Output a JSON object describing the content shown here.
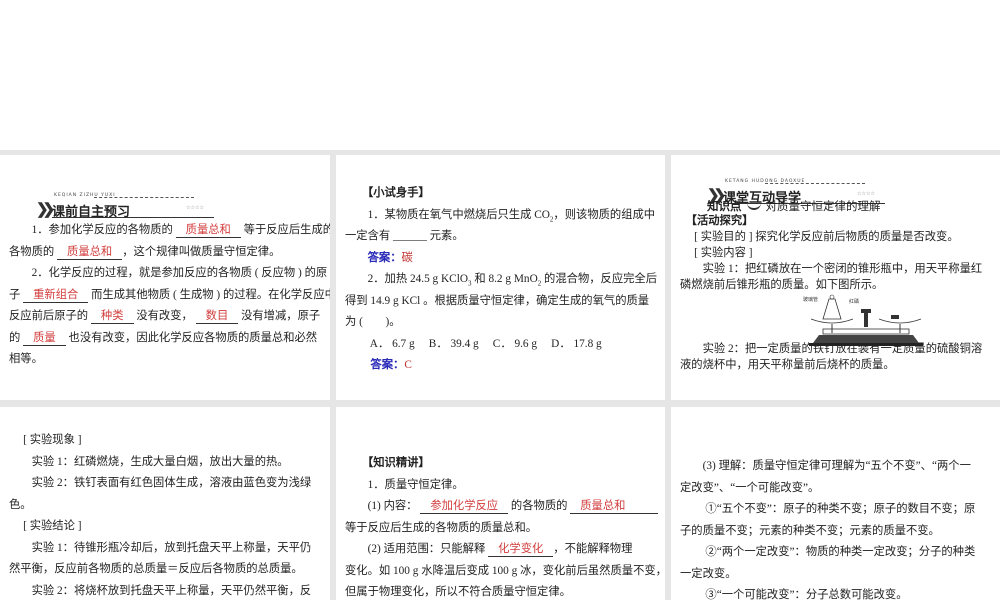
{
  "panels": [
    {
      "banner": {
        "pinyin": "KEQIAN ZIZHU YUXI",
        "title": "课前自主预习",
        "stars": "☆☆☆☆"
      },
      "lines": [
        [
          {
            "t": "　　1．参加化学反应的各物质的 "
          },
          {
            "a": "质量总和"
          },
          {
            "t": " 等于反应后生成的"
          }
        ],
        [
          {
            "t": "各物质的 "
          },
          {
            "a": "质量总和"
          },
          {
            "t": "，这个规律叫做质量守恒定律。"
          }
        ],
        [
          {
            "t": "　　2．化学反应的过程，就是参加反应的各物质 ( 反应物 ) 的原"
          }
        ],
        [
          {
            "t": "子 "
          },
          {
            "a": "重新组合"
          },
          {
            "t": " 而生成其他物质 ( 生成物 ) 的过程。在化学反应中，"
          }
        ],
        [
          {
            "t": "反应前后原子的 "
          },
          {
            "a": "种类"
          },
          {
            "t": " 没有改变， "
          },
          {
            "a": "数目"
          },
          {
            "t": " 没有增减，原子"
          }
        ],
        [
          {
            "t": "的 "
          },
          {
            "a": "质量"
          },
          {
            "t": " 也没有改变，因此化学反应各物质的质量总和必然"
          }
        ],
        [
          {
            "t": " 相等。"
          }
        ]
      ]
    },
    {
      "lines": [
        [
          {
            "b": "　　【小试身手】"
          }
        ],
        [
          {
            "t": "　　1．某物质在氧气中燃烧后只生成 CO"
          },
          {
            "sub": "2"
          },
          {
            "t": "，则该物质的组成中"
          }
        ],
        [
          {
            "t": "一定含有 ______ 元素。"
          }
        ],
        [
          {
            "t": "　　"
          },
          {
            "k": "答案："
          },
          {
            "r": "碳"
          }
        ],
        [
          {
            "t": "　　2．加热 24.5 g KClO"
          },
          {
            "sub": "3"
          },
          {
            "t": " 和 8.2 g MnO"
          },
          {
            "sub": "2"
          },
          {
            "t": " 的混合物，反应完全后"
          }
        ],
        [
          {
            "t": "得到 14.9 g KCl 。根据质量守恒定律，确定生成的氧气的质量"
          }
        ],
        [
          {
            "t": "  为 (　　)。"
          }
        ],
        [
          {
            "t": "　　 A． 6.7 g　 B． 39.4 g　 C． 9.6 g　 D． 17.8 g"
          }
        ],
        [
          {
            "t": "　　 "
          },
          {
            "k": "答案："
          },
          {
            "r": "C"
          }
        ]
      ]
    },
    {
      "banner": {
        "pinyin": "KETANG HUDONG DAOXUE",
        "title": "课堂互动导学",
        "stars": "☆☆☆☆"
      },
      "knowledge_point": {
        "label": "知识点",
        "title": "对质量守恒定律的理解"
      },
      "figure_labels": {
        "tube": "玻璃管",
        "phosphorus": "红磷"
      },
      "lines": [
        [
          {
            "b": "　【活动探究】"
          }
        ],
        [
          {
            "t": "　 [ 实验目的 ] 探究化学反应前后物质的质量是否改变。"
          }
        ],
        [
          {
            "t": "　 [ 实验内容 ]"
          }
        ],
        [
          {
            "t": "　　实验 1：把红磷放在一个密闭的锥形瓶中，用天平称量红"
          }
        ],
        [
          {
            "t": "磷燃烧前后锥形瓶的质量。如下图所示。"
          }
        ],
        [],
        [],
        [],
        [
          {
            "t": "　　实验 2：把一定质量的铁钉放在装有一定质量的硫酸铜溶"
          }
        ],
        [
          {
            "t": "液的烧杯中，用天平称量前后烧杯的质量。"
          }
        ]
      ]
    },
    {
      "lines": [
        [
          {
            "t": "　 [ 实验现象 ]"
          }
        ],
        [
          {
            "t": "　　实验 1：红磷燃烧，生成大量白烟，放出大量的热。"
          }
        ],
        [
          {
            "t": "　　实验 2：铁钉表面有红色固体生成，溶液由蓝色变为浅绿"
          }
        ],
        [
          {
            "t": "色。"
          }
        ],
        [
          {
            "t": "　 [ 实验结论 ]"
          }
        ],
        [
          {
            "t": "　　实验 1：待锥形瓶冷却后，放到托盘天平上称量，天平仍"
          }
        ],
        [
          {
            "t": "然平衡，反应前各物质的总质量＝反应后各物质的总质量。"
          }
        ],
        [
          {
            "t": "　　实验 2：将烧杯放到托盘天平上称量，天平仍然平衡，反"
          }
        ]
      ]
    },
    {
      "lines": [
        [
          {
            "b": "　　【知识精讲】"
          }
        ],
        [
          {
            "t": "　　1．质量守恒定律。"
          }
        ],
        [
          {
            "t": "　　(1) 内容： "
          },
          {
            "a": "参加化学反应"
          },
          {
            "t": " 的各物质的 "
          },
          {
            "a": "质量总和　　"
          }
        ],
        [
          {
            "t": "等于反应后生成的各物质的质量总和。"
          }
        ],
        [
          {
            "t": "　　(2) 适用范围：只能解释 "
          },
          {
            "a": "化学变化"
          },
          {
            "t": "，不能解释物理"
          }
        ],
        [
          {
            "t": "变化。如 100 g 水降温后变成 100 g 冰，变化前后虽然质量不变，"
          }
        ],
        [
          {
            "t": "但属于物理变化，所以不符合质量守恒定律。"
          }
        ]
      ]
    },
    {
      "lines": [
        [
          {
            "t": "　　(3) 理解：质量守恒定律可理解为“五个不变”、“两个一"
          }
        ],
        [
          {
            "t": "定改变”、“一个可能改变”。"
          }
        ],
        [
          {
            "t": "　　 ①“五个不变”：原子的种类不变；原子的数目不变；原"
          }
        ],
        [
          {
            "t": " 子的质量不变；元素的种类不变；元素的质量不变。"
          }
        ],
        [
          {
            "t": "　　 ②“两个一定改变”：物质的种类一定改变；分子的种类"
          }
        ],
        [
          {
            "t": "  一定改变。"
          }
        ],
        [
          {
            "t": "　　 ③“一个可能改变”：分子总数可能改变。"
          }
        ]
      ]
    }
  ]
}
